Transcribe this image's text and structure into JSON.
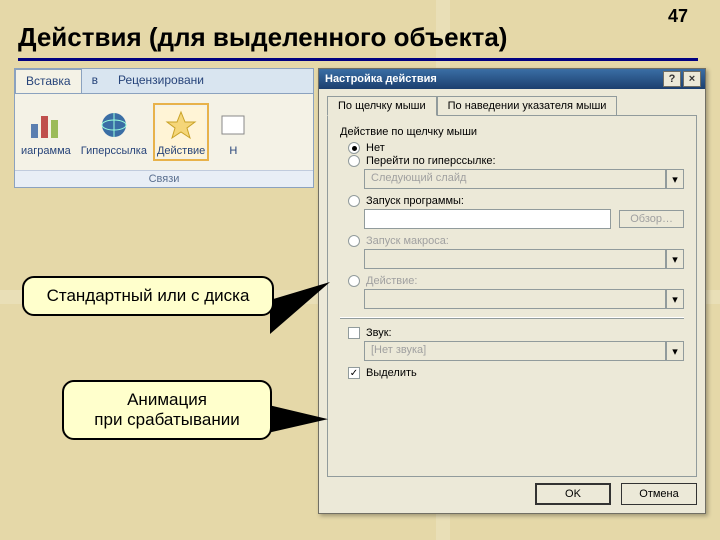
{
  "page_number": "47",
  "heading": "Действия (для выделенного объекта)",
  "ribbon": {
    "tabs": [
      "Вставка",
      "в",
      "Рецензировани"
    ],
    "items": [
      "иаграмма",
      "Гиперссылка",
      "Действие",
      "Н"
    ],
    "group_label": "Связи"
  },
  "dialog": {
    "title": "Настройка действия",
    "help_btn": "?",
    "close_btn": "×",
    "tabs": [
      "По щелчку мыши",
      "По наведении указателя мыши"
    ],
    "section_label": "Действие по щелчку мыши",
    "radio_none": "Нет",
    "radio_hyperlink": "Перейти по гиперссылке:",
    "hyperlink_value": "Следующий слайд",
    "radio_run": "Запуск программы:",
    "browse_btn": "Обзор…",
    "radio_macro": "Запуск макроса:",
    "radio_action": "Действие:",
    "sound_check": "Звук:",
    "sound_value": "[Нет звука]",
    "highlight_check": "Выделить",
    "ok_btn": "OK",
    "cancel_btn": "Отмена"
  },
  "callouts": {
    "c1": "Стандартный или с диска",
    "c2_line1": "Анимация",
    "c2_line2": "при срабатывании"
  }
}
